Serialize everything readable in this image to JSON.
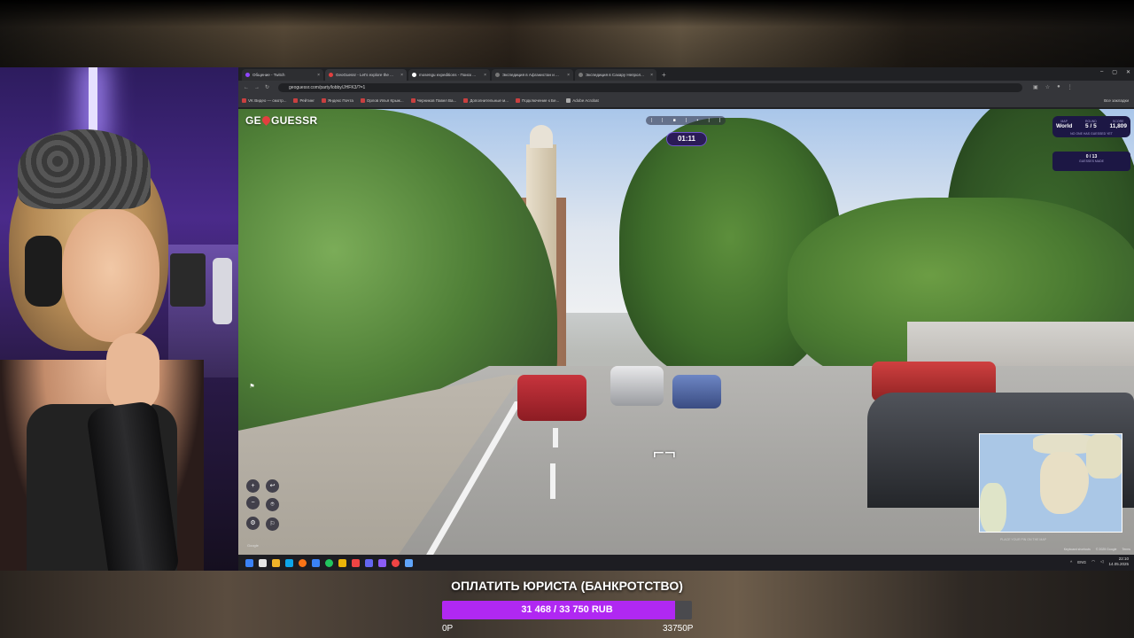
{
  "browser": {
    "tabs": [
      {
        "label": "Общение - Twitch",
        "active": false
      },
      {
        "label": "GeoGuessr - Let's explore the ...",
        "active": true
      },
      {
        "label": "mosengu expeditions - Поиск ...",
        "active": false
      },
      {
        "label": "Экспедиция в Афганистан и ...",
        "active": false
      },
      {
        "label": "Экспедиция в Сахару Непрол...",
        "active": false
      }
    ],
    "url": "geoguessr.com/party/lobby/JHFK3/?=1",
    "bookmarks": [
      "VK Видео — смотр...",
      "Рейтинг",
      "Яндекс Почта",
      "Орлов Илья Крыж...",
      "Черников Павел Ва...",
      "Дополнительные м...",
      "Подключение к Бе...",
      "Adobe Acrobat"
    ],
    "all_bookmarks_label": "Все закладки"
  },
  "game": {
    "logo_left": "GE",
    "logo_right": "GUESSR",
    "timer": "01:11",
    "map_label": "MAP",
    "map_value": "World",
    "round_label": "ROUND",
    "round_value": "5 / 5",
    "score_label": "SCORE",
    "score_value": "11,809",
    "no_guess_note": "NO ONE HAS GUESSED YET",
    "guesses_value": "0 / 13",
    "guesses_label": "GUESSES MADE",
    "minimap_hint": "PLACE YOUR PIN ON THE MAP",
    "google_stamp": "Google",
    "footer_links": [
      "Keyboard shortcuts",
      "© 2025 Google",
      "Terms"
    ]
  },
  "taskbar": {
    "lang": "ENG",
    "time": "22:10",
    "date": "14.05.2025"
  },
  "goal": {
    "title": "ОПЛАТИТЬ ЮРИСТА (БАНКРОТСТВО)",
    "progress_text": "31 468 / 33 750 RUB",
    "progress_fraction": 0.932,
    "min_label": "0Р",
    "max_label": "33750Р",
    "fill_color": "#b028f2"
  }
}
